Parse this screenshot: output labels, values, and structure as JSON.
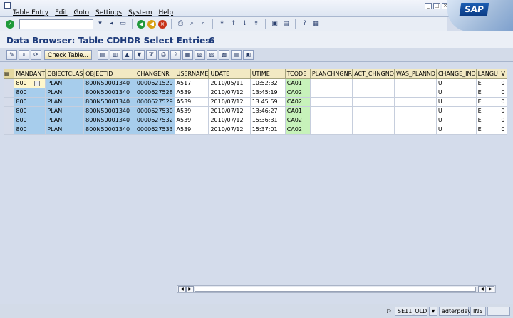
{
  "menu": [
    "Table Entry",
    "Edit",
    "Goto",
    "Settings",
    "System",
    "Help"
  ],
  "logo_text": "SAP",
  "title": "Data Browser: Table CDHDR Select Entries",
  "entry_count": "6",
  "check_table_label": "Check Table...",
  "columns": [
    "MANDANT",
    "OBJECTCLAS",
    "OBJECTID",
    "CHANGENR",
    "USERNAME",
    "UDATE",
    "UTIME",
    "TCODE",
    "PLANCHNGNR",
    "ACT_CHNGNO",
    "WAS_PLANND",
    "CHANGE_IND",
    "LANGU",
    "V"
  ],
  "rows": [
    [
      "800",
      "PLAN",
      "800N50001340",
      "0000621529",
      "A517",
      "2010/05/11",
      "10:52:32",
      "CA01",
      "",
      "",
      "",
      "U",
      "E",
      "0"
    ],
    [
      "800",
      "PLAN",
      "800N50001340",
      "0000627528",
      "A539",
      "2010/07/12",
      "13:45:19",
      "CA02",
      "",
      "",
      "",
      "U",
      "E",
      "0"
    ],
    [
      "800",
      "PLAN",
      "800N50001340",
      "0000627529",
      "A539",
      "2010/07/12",
      "13:45:59",
      "CA02",
      "",
      "",
      "",
      "U",
      "E",
      "0"
    ],
    [
      "800",
      "PLAN",
      "800N50001340",
      "0000627530",
      "A539",
      "2010/07/12",
      "13:46:27",
      "CA01",
      "",
      "",
      "",
      "U",
      "E",
      "0"
    ],
    [
      "800",
      "PLAN",
      "800N50001340",
      "0000627532",
      "A539",
      "2010/07/12",
      "15:36:31",
      "CA02",
      "",
      "",
      "",
      "U",
      "E",
      "0"
    ],
    [
      "800",
      "PLAN",
      "800N50001340",
      "0000627533",
      "A539",
      "2010/07/12",
      "15:37:01",
      "CA02",
      "",
      "",
      "",
      "U",
      "E",
      "0"
    ]
  ],
  "status": {
    "transaction": "SE11_OLD",
    "server": "adterpdev",
    "mode": "INS"
  }
}
